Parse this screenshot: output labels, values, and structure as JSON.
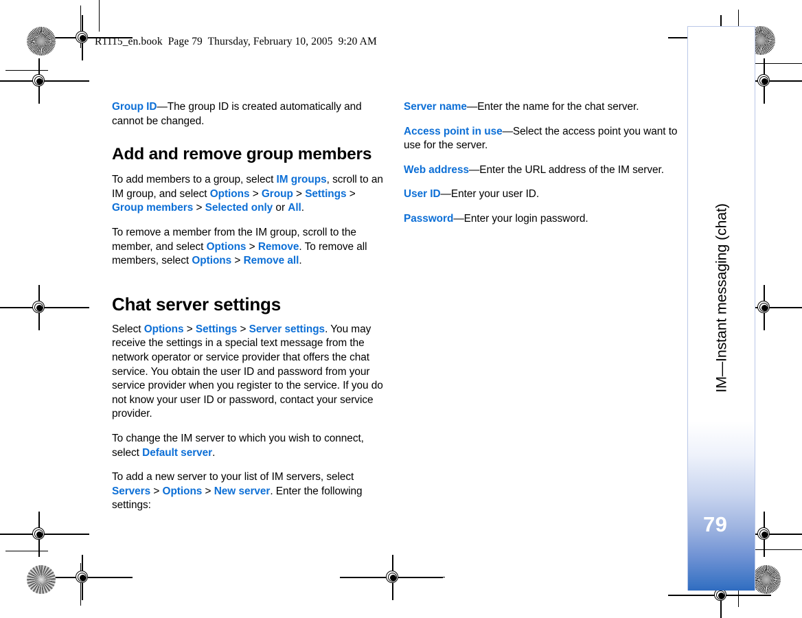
{
  "print_header": "R1115_en.book  Page 79  Thursday, February 10, 2005  9:20 AM",
  "colors": {
    "ui_term_blue": "#0d6fd6",
    "sidebar_blue": "#2f6cc0",
    "sidebar_rule": "#b9c7e8",
    "text_black": "#000000"
  },
  "sidebar": {
    "chapter_title": "IM—Instant messaging (chat)",
    "page_number": "79"
  },
  "left_column": {
    "group_id_para": {
      "term": "Group ID",
      "text": "—The group ID is created automatically and cannot be changed."
    },
    "heading_add_remove": "Add and remove group members",
    "add_members_para": {
      "t1": "To add members to a group, select ",
      "u1": "IM groups",
      "t2": ", scroll to an IM group, and select ",
      "u2": "Options",
      "s1": " > ",
      "u3": "Group",
      "s2": " > ",
      "u4": "Settings",
      "s3": " > ",
      "u5": "Group members",
      "s4": " > ",
      "u6": "Selected only",
      "t3": " or ",
      "u7": "All",
      "t4": "."
    },
    "remove_member_para": {
      "t1": "To remove a member from the IM group, scroll to the member, and select ",
      "u1": "Options",
      "s1": " > ",
      "u2": "Remove",
      "t2": ". To remove all members, select ",
      "u3": "Options",
      "s2": " > ",
      "u4": "Remove all",
      "t3": "."
    },
    "heading_chat_server": "Chat server settings",
    "select_options_para": {
      "t1": "Select ",
      "u1": "Options",
      "s1": " > ",
      "u2": "Settings",
      "s2": " > ",
      "u3": "Server settings",
      "t2": ". You may receive the settings in a special text message from the network operator or service provider that offers the chat service. You obtain the user ID and password from your service provider when you register to the service. If you do not know your user ID or password, contact your service provider."
    },
    "change_server_para": {
      "t1": "To change the IM server to which you wish to connect, select ",
      "u1": "Default server",
      "t2": "."
    },
    "add_server_para": {
      "t1": "To add a new server to your list of IM servers, select ",
      "u1": "Servers",
      "s1": " > ",
      "u2": "Options",
      "s2": " > ",
      "u3": "New server",
      "t2": ". Enter the following settings:"
    }
  },
  "right_column": {
    "server_name": {
      "term": "Server name",
      "text": "—Enter the name for the chat server."
    },
    "access_point": {
      "term": "Access point in use",
      "text": "—Select the access point you want to use for the server."
    },
    "web_address": {
      "term": "Web address",
      "text": "—Enter the URL address of the IM server."
    },
    "user_id": {
      "term": "User ID",
      "text": "—Enter your user ID."
    },
    "password": {
      "term": "Password",
      "text": "—Enter your login password."
    }
  }
}
